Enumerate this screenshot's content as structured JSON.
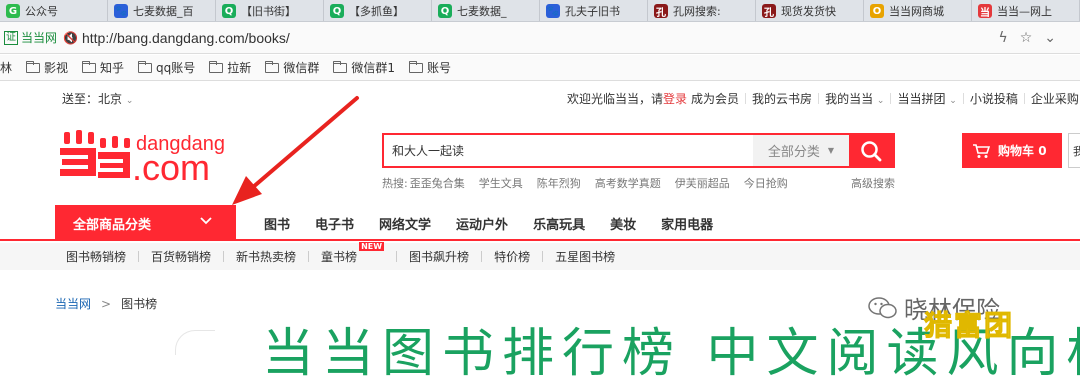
{
  "browser": {
    "tabs": [
      {
        "title": "公众号",
        "icon_color": "#2dbb4e",
        "icon": "wechat-circle-icon",
        "glyph": "G"
      },
      {
        "title": "七麦数据_百",
        "icon_color": "#2b5fd9",
        "icon": "paw-icon",
        "glyph": "🐾"
      },
      {
        "title": "【旧书街】",
        "icon_color": "#1aad5a",
        "icon": "q-icon",
        "glyph": "Q"
      },
      {
        "title": "【多抓鱼】",
        "icon_color": "#1aad5a",
        "icon": "q-icon",
        "glyph": "Q"
      },
      {
        "title": "七麦数据_",
        "icon_color": "#1aad5a",
        "icon": "q-icon",
        "glyph": "Q"
      },
      {
        "title": "孔夫子旧书",
        "icon_color": "#2b5fd9",
        "icon": "paw-icon",
        "glyph": "🐾"
      },
      {
        "title": "孔网搜索:",
        "icon_color": "#8b1a1a",
        "icon": "kong-icon",
        "glyph": "孔"
      },
      {
        "title": "现货发货快",
        "icon_color": "#8b1a1a",
        "icon": "kong-icon",
        "glyph": "孔"
      },
      {
        "title": "当当网商城",
        "icon_color": "#e8a300",
        "icon": "o-icon",
        "glyph": "O"
      },
      {
        "title": "当当—网上",
        "icon_color": "#e4393c",
        "icon": "dangdang-icon",
        "glyph": "当"
      }
    ],
    "site_badge": "证",
    "site_name": "当当网",
    "url": "http://bang.dangdang.com/books/",
    "bookmarks": [
      "林",
      "影视",
      "知乎",
      "qq账号",
      "拉新",
      "微信群",
      "微信群1",
      "账号"
    ]
  },
  "topnav": {
    "deliver_to": "送至：北京",
    "welcome": "欢迎光临当当，请",
    "login": "登录",
    "register": "成为会员",
    "links": [
      "我的云书房",
      "我的当当",
      "当当拼团",
      "小说投稿",
      "企业采购"
    ]
  },
  "logo": {
    "brand": "dangdang",
    "domain": ".com"
  },
  "search": {
    "value": "和大人一起读",
    "category": "全部分类",
    "hot_label": "热搜:",
    "hotwords": [
      "歪歪兔合集",
      "学生文具",
      "陈年烈狗",
      "高考数学真题",
      "伊芙丽超品",
      "今日抢购"
    ],
    "advanced": "高级搜索"
  },
  "cart": {
    "label": "购物车",
    "count": "0",
    "edge": "我"
  },
  "mainnav": {
    "all_categories": "全部商品分类",
    "links": [
      "图书",
      "电子书",
      "网络文学",
      "运动户外",
      "乐高玩具",
      "美妆",
      "家用电器"
    ]
  },
  "subnav": {
    "links": [
      "图书畅销榜",
      "百货畅销榜",
      "新书热卖榜",
      "童书榜",
      "图书飙升榜",
      "特价榜",
      "五星图书榜"
    ],
    "new_badge": "NEW"
  },
  "breadcrumb": {
    "home": "当当网",
    "sep": ">",
    "current": "图书榜"
  },
  "page_title": "当当图书排行榜 中文阅读风向标",
  "watermarks": {
    "wechat": "晓林保险",
    "group": "猎富团"
  },
  "colors": {
    "accent": "#ff2832",
    "title_green": "#1aa260",
    "link_blue": "#1a66b3"
  }
}
